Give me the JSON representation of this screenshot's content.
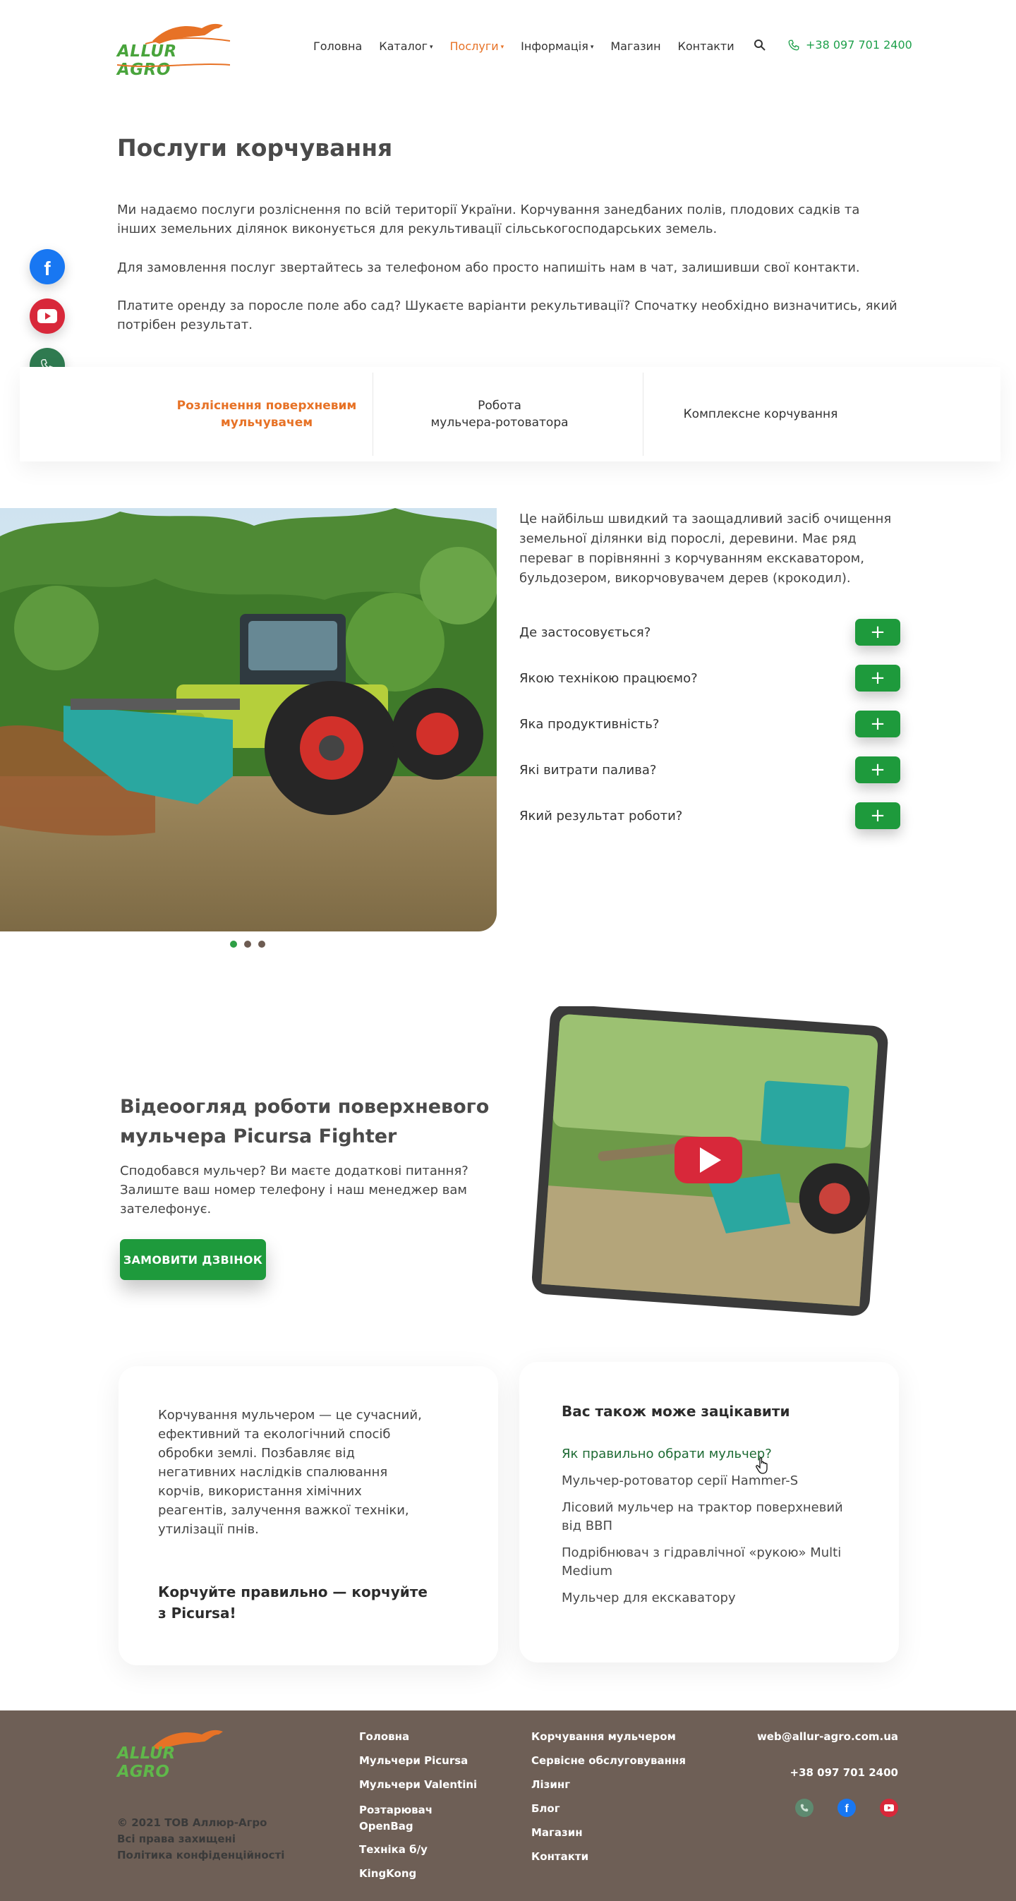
{
  "header": {
    "logo_text": "ALLUR AGRO",
    "nav": [
      {
        "label": "Головна",
        "has_caret": false,
        "active": false
      },
      {
        "label": "Каталог",
        "has_caret": true,
        "active": false
      },
      {
        "label": "Послуги",
        "has_caret": true,
        "active": true
      },
      {
        "label": "Інформація",
        "has_caret": true,
        "active": false
      },
      {
        "label": "Магазин",
        "has_caret": false,
        "active": false
      },
      {
        "label": "Контакти",
        "has_caret": false,
        "active": false
      }
    ],
    "phone": "+38 097 701 2400"
  },
  "page": {
    "title": "Послуги корчування",
    "intro": [
      "Ми надаємо послуги розліснення по всій території України. Корчування занедбаних полів, плодових садків та інших земельних ділянок виконується для рекультивації сільськогосподарських земель.",
      "Для замовлення послуг звертайтесь за телефоном або просто напишіть нам в чат, залишивши свої контакти.",
      "Платите оренду за поросле поле або сад? Шукаєте варіанти рекультивації? Спочатку необхідно визначитись, який потрібен результат."
    ]
  },
  "tabs": [
    {
      "line1": "Розліснення поверхневим",
      "line2": "мульчувачем"
    },
    {
      "line1": "Робота",
      "line2": "мульчера-ротоватора"
    },
    {
      "line1": "Комплексне корчування",
      "line2": ""
    }
  ],
  "slider": {
    "description": "Це найбільш швидкий та заощадливий засіб очищення земельної ділянки від порослі, деревини. Має ряд переваг в порівнянні з корчуванням екскаватором, бульдозером, викорчовувачем дерев (крокодил).",
    "questions": [
      "Де застосовується?",
      "Якою технікою працюємо?",
      "Яка продуктивність?",
      "Які витрати палива?",
      "Який результат роботи?"
    ],
    "plus": "+"
  },
  "video": {
    "title": "Відеоогляд роботи поверхневого мульчера Picursa Fighter",
    "description": "Сподобався мульчер? Ви маєте додаткові питання? Залиште ваш номер телефону і наш менеджер вам зателефонує.",
    "cta": "ЗАМОВИТИ ДЗВІНОК"
  },
  "info_card": {
    "text": "Корчування мульчером — це сучасний, ефективний та екологічний спосіб обробки землі. Позбавляє від негативних наслідків спалювання корчів, використання хімічних реагентів, залучення важкої техніки, утилізації пнів.",
    "strong": "Корчуйте правильно — корчуйте з Picursa!"
  },
  "related": {
    "title": "Вас також може зацікавити",
    "links": [
      "Як правильно обрати мульчер?",
      "Мульчер-ротоватор серії Hammer-S",
      "Лісовий мульчер на трактор поверхневий від ВВП",
      "Подрібнювач з гідравлічної «рукою» Multi Medium",
      "Мульчер для екскаватору"
    ]
  },
  "footer": {
    "col1": [
      "Головна",
      "Мульчери Picursa",
      "Мульчери Valentini",
      "Розтарювач OpenBag",
      "Техніка б/у",
      "KingKong"
    ],
    "col2": [
      "Корчування мульчером",
      "Сервісне обслуговування",
      "Лізинг",
      "Блог",
      "Магазин",
      "Контакти"
    ],
    "email": "web@allur-agro.com.ua",
    "phone": "+38 097 701 2400",
    "copyright": "© 2021 ТОВ Аллюр-Агро",
    "rights": "Всі права захищені",
    "policy": "Політика конфіденційності"
  },
  "colors": {
    "accent_green": "#1e9a3c",
    "accent_orange": "#e77226",
    "footer_bg": "#6e5f56"
  }
}
